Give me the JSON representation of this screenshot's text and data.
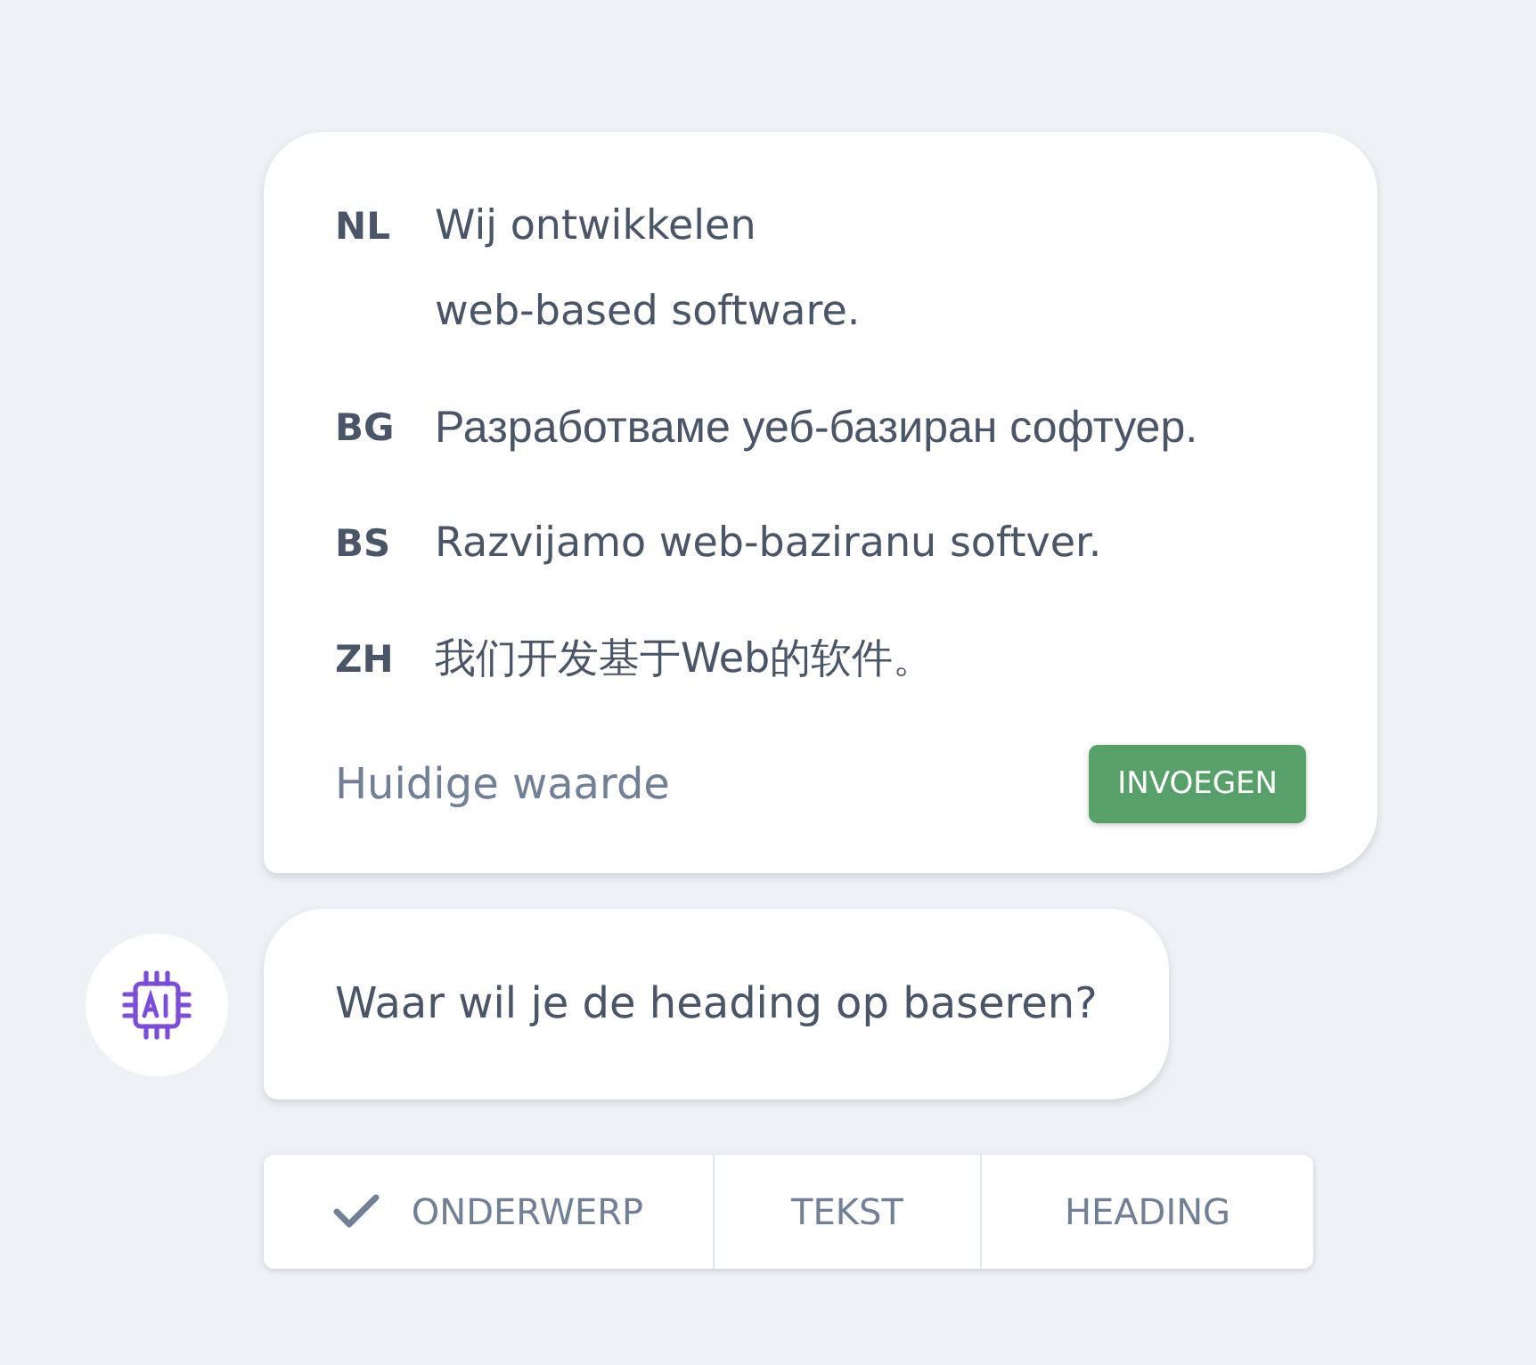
{
  "translations": [
    {
      "code": "NL",
      "text": "Wij ontwikkelen\nweb-based software."
    },
    {
      "code": "BG",
      "text": "Разработваме уеб-базиран софтуер."
    },
    {
      "code": "BS",
      "text": "Razvijamo web-baziranu softver."
    },
    {
      "code": "ZH",
      "text": "我们开发基于Web的软件。"
    }
  ],
  "current_value_label": "Huidige waarde",
  "insert_button": "INVOEGEN",
  "question": "Waar wil je de heading op baseren?",
  "options": [
    {
      "label": "ONDERWERP",
      "selected": true
    },
    {
      "label": "TEKST",
      "selected": false
    },
    {
      "label": "HEADING",
      "selected": false
    }
  ]
}
